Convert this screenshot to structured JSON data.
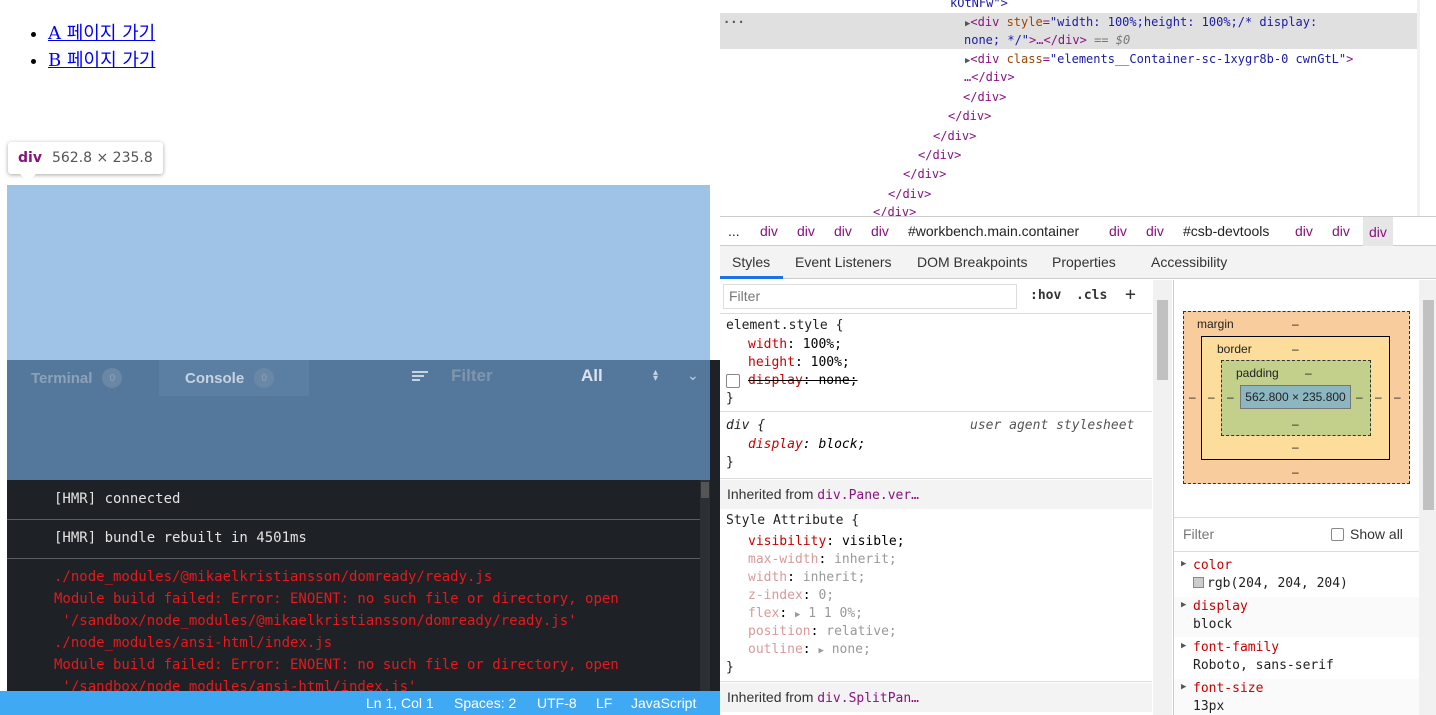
{
  "preview": {
    "links": [
      "A 페이지 가기",
      "B 페이지 가기"
    ],
    "tooltip": {
      "tag": "div",
      "dims": "562.8 × 235.8"
    }
  },
  "sandbox_devtools": {
    "tabs": [
      {
        "label": "Terminal",
        "count": "0"
      },
      {
        "label": "Console",
        "count": "0"
      }
    ],
    "filter_placeholder": "Filter",
    "level": "All",
    "logs": [
      "[HMR] connected",
      "[HMR] bundle rebuilt in 4501ms"
    ],
    "errors": [
      "./node_modules/@mikaelkristiansson/domready/ready.js",
      "Module build failed: Error: ENOENT: no such file or directory, open",
      " '/sandbox/node_modules/@mikaelkristiansson/domready/ready.js'",
      "./node_modules/ansi-html/index.js",
      "Module build failed: Error: ENOENT: no such file or directory, open",
      " '/sandbox/node_modules/ansi-html/index.js'"
    ]
  },
  "statusbar": {
    "position": "Ln 1, Col 1",
    "spaces": "Spaces: 2",
    "encoding": "UTF-8",
    "eol": "LF",
    "language": "JavaScript"
  },
  "dom_tree": {
    "top_fragment": "kOtNFw\">",
    "row1_open": "<div",
    "row1_attr": "style",
    "row1_val": "\"width: 100%;height: 100%;/* display:",
    "row1b_val": "none; */\"",
    "row1b_rest": ">…</div>",
    "row1b_eq": "== $0",
    "row2_open": "<div",
    "row2_attr": "class",
    "row2_val": "\"elements__Container-sc-1xygr8b-0 cwnGtL\"",
    "row2_close": ">",
    "row2b": "…</div>",
    "closing": "</div>",
    "ellipsis": "…"
  },
  "breadcrumbs": [
    "...",
    "div",
    "div",
    "div",
    "div",
    "#workbench.main.container",
    "div",
    "div",
    "#csb-devtools",
    "div",
    "div",
    "div"
  ],
  "panel_tabs": [
    "Styles",
    "Event Listeners",
    "DOM Breakpoints",
    "Properties",
    "Accessibility"
  ],
  "styles": {
    "filter_placeholder": "Filter",
    "hov": ":hov",
    "cls": ".cls",
    "plus": "+",
    "element_style": {
      "selector": "element.style {",
      "props": [
        {
          "name": "width",
          "value": "100%;"
        },
        {
          "name": "height",
          "value": "100%;"
        },
        {
          "name": "display",
          "value": "none;"
        }
      ],
      "close": "}"
    },
    "ua_rule": {
      "selector": "div {",
      "source": "user agent stylesheet",
      "prop": "display",
      "value": "block;",
      "close": "}"
    },
    "inherited1": {
      "label": "Inherited from ",
      "link": "div.Pane.ver…"
    },
    "style_attr": {
      "selector": "Style Attribute {",
      "props": [
        {
          "name": "visibility",
          "value": "visible;"
        },
        {
          "name": "max-width",
          "value": "inherit;"
        },
        {
          "name": "width",
          "value": "inherit;"
        },
        {
          "name": "z-index",
          "value": "0;"
        },
        {
          "name": "flex",
          "value": "1 1 0%;"
        },
        {
          "name": "position",
          "value": "relative;"
        },
        {
          "name": "outline",
          "value": "none;"
        }
      ],
      "close": "}"
    },
    "inherited2": {
      "label": "Inherited from ",
      "link": "div.SplitPan…"
    }
  },
  "box_model": {
    "margin": "margin",
    "border": "border",
    "padding": "padding",
    "content": "562.800 × 235.800",
    "dash": "–"
  },
  "computed": {
    "filter_placeholder": "Filter",
    "show_all": "Show all",
    "items": [
      {
        "name": "color",
        "value": "rgb(204, 204, 204)"
      },
      {
        "name": "display",
        "value": "block"
      },
      {
        "name": "font-family",
        "value": "Roboto, sans-serif"
      },
      {
        "name": "font-size",
        "value": "13px"
      }
    ]
  }
}
